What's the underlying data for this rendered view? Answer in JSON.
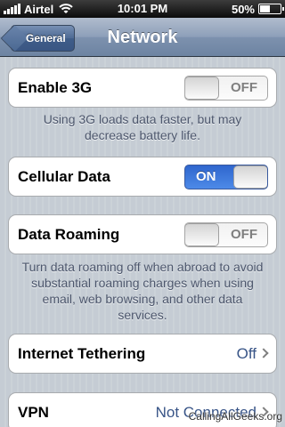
{
  "status_bar": {
    "carrier": "Airtel",
    "time": "10:01 PM",
    "battery_percent": "50%",
    "battery_level": 0.5,
    "signal_icon": "signal-bars-icon",
    "wifi_icon": "wifi-icon"
  },
  "nav": {
    "back_label": "General",
    "title": "Network"
  },
  "settings": {
    "enable_3g": {
      "label": "Enable 3G",
      "state": "OFF"
    },
    "enable_3g_note": "Using 3G loads data faster, but may decrease battery life.",
    "cellular_data": {
      "label": "Cellular Data",
      "state": "ON"
    },
    "data_roaming": {
      "label": "Data Roaming",
      "state": "OFF"
    },
    "data_roaming_note": "Turn data roaming off when abroad to avoid substantial roaming charges when using email, web browsing, and other data services.",
    "internet_tethering": {
      "label": "Internet Tethering",
      "value": "Off"
    },
    "vpn": {
      "label": "VPN",
      "value": "Not Connected"
    }
  },
  "watermark": "CallingAllGeeks.org",
  "colors": {
    "toggle_on": "#3b74dc",
    "nav_bar": "#6d84a2",
    "value_text": "#385487",
    "background": "#c5ccd4"
  }
}
